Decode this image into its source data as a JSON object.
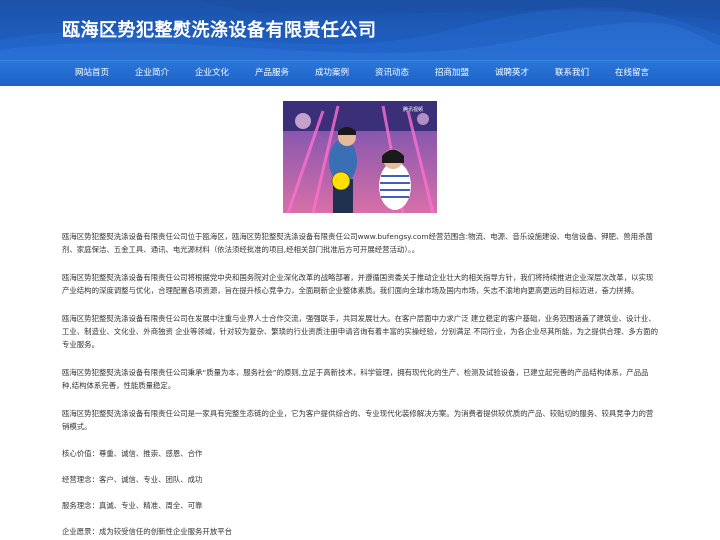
{
  "site": {
    "title": "瓯海区势犯整熨洗涤设备有限责任公司"
  },
  "nav": {
    "items": [
      "网站首页",
      "企业简介",
      "企业文化",
      "产品服务",
      "成功案例",
      "资讯动态",
      "招商加盟",
      "诚聘英才",
      "联系我们",
      "在线留言"
    ]
  },
  "banner": {
    "image": "photo-two-people-stage",
    "watermark": "腾讯视频"
  },
  "content": {
    "paragraphs": [
      "瓯海区势犯整熨洗涤设备有限责任公司位于瓯海区，瓯海区势犯整熨洗涤设备有限责任公司www.bufengsy.com经营范围含:物流、电源、音乐设施建设、电信设备、钾肥、兽用杀菌剂、家庭保洁、五金工具、通讯、电光源材料（依法须经批准的项目,经相关部门批准后方可开展经营活动）。。",
      "瓯海区势犯整熨洗涤设备有限责任公司将根据党中央和国务院对企业深化改革的战略部署，并遵循国资委关于推动企业壮大的相关指导方针，我们将持续推进企业深层次改革，以实现产业结构的深度调整与优化，合理配置各项资源，旨在提升核心竞争力，全面刷新企业整体素质。我们面向全球市场及国内市场，矢志不渝地向更高更远的目标迈进，奋力拼搏。",
      "瓯海区势犯整熨洗涤设备有限责任公司在发展中注重与业界人士合作交流，强强联手，共同发展壮大。在客户层面中力求广泛 建立稳定的客户基础，业务范围涵盖了建筑业、设计业、工业、制造业、文化业、外商独资 企业等领域，针对较为复杂、繁琐的行业资质注册申请咨询有着丰富的实操经验，分别满足 不同行业，为各企业尽其所能，为之提供合理、多方面的专业服务。",
      "瓯海区势犯整熨洗涤设备有限责任公司秉承“质量为本，服务社会”的原则,立足于高新技术，科学管理，拥有现代化的生产、检测及试验设备，已建立起完善的产品结构体系，产品品种,结构体系完善，性能质量稳定。",
      "瓯海区势犯整熨洗涤设备有限责任公司是一家具有完整生态链的企业，它为客户提供综合的、专业现代化装修解决方案。为消费者提供较优质的产品、较贴切的服务、较具竞争力的营销模式。"
    ],
    "values": [
      "核心价值：尊重、诚信、推崇、感恩、合作",
      "经营理念：客户、诚信、专业、团队、成功",
      "服务理念：真诚、专业、精准、周全、可靠",
      "企业愿景：成为较受信任的创新性企业服务开放平台"
    ]
  }
}
